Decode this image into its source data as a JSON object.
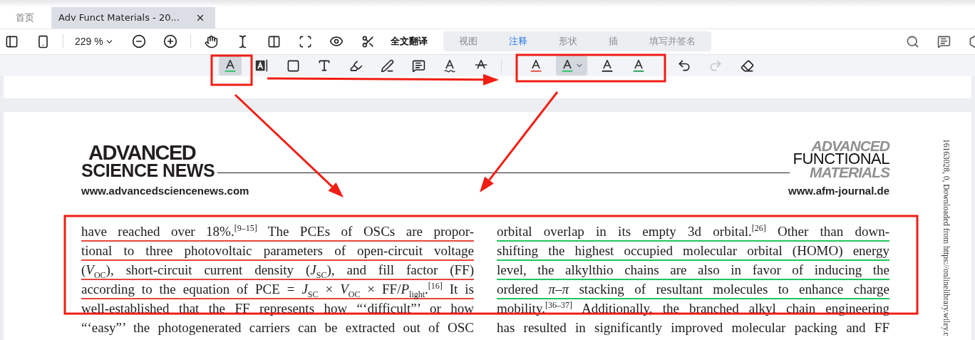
{
  "window_tabs": [
    {
      "label": "首页",
      "selected": false
    },
    {
      "label": "Adv Funct Materials - 20...",
      "selected": true
    }
  ],
  "toolbar": {
    "zoom": "229 %",
    "translate": "全文翻译",
    "modes": [
      {
        "label": "视图",
        "selected": false
      },
      {
        "label": "注释",
        "selected": true
      },
      {
        "label": "形状",
        "selected": false
      },
      {
        "label": "插",
        "selected": false
      },
      {
        "label": "填写并签名",
        "selected": false
      }
    ]
  },
  "annotation_tools": [
    {
      "kind": "highlight",
      "selected": true
    },
    {
      "kind": "textbox",
      "selected": false
    },
    {
      "kind": "rectangle",
      "selected": false
    },
    {
      "kind": "text",
      "selected": false
    },
    {
      "kind": "marker",
      "selected": false
    },
    {
      "kind": "pencil",
      "selected": false
    },
    {
      "kind": "note",
      "selected": false
    },
    {
      "kind": "squiggly",
      "selected": false
    },
    {
      "kind": "strikeout",
      "selected": false
    }
  ],
  "annotation_colors": [
    {
      "color": "#e8453c",
      "selected": false
    },
    {
      "color": "#22c55e",
      "selected": true
    },
    {
      "color": "#222222",
      "selected": false
    },
    {
      "color": "#1a9a4f",
      "selected": false
    }
  ],
  "history": [
    {
      "kind": "undo",
      "disabled": false
    },
    {
      "kind": "redo",
      "disabled": true
    }
  ],
  "document": {
    "left_logo": {
      "line_1": "ADVANCED",
      "line_2": "SCIENCE NEWS",
      "url": "www.advancedsciencenews.com"
    },
    "right_logo": {
      "line_1": "ADVANCED",
      "line_2": "FUNCTIONAL",
      "line_3": "MATERIALS",
      "url": "www.afm-journal.de"
    },
    "side_note": "16163028, 0, Downloaded from https://onlinelibrary.wiley.c",
    "columns": [
      {
        "color": "#e8453c",
        "lines": [
          {
            "text": "have reached over 18%.$^{[9–15]}$ The PCEs of OSCs are propor-",
            "underlined": true
          },
          {
            "text": "tional to three photovoltaic parameters of open-circuit voltage",
            "underlined": true
          },
          {
            "text": "(*V*$_{OC}$), short-circuit current density (*J*$_{SC}$), and fill factor (FF)",
            "underlined": true
          },
          {
            "text": "according to the equation of PCE = *J*$_{SC}$ × *V*$_{OC}$ × FF/*P*$_{light}$.$^{[16]}$ It is",
            "underlined": true
          },
          {
            "text": "well-established that the FF represents how “‘difficult”’ or how",
            "underlined": false
          },
          {
            "text": "“‘easy”’ the photogenerated carriers can be extracted out of OSC",
            "underlined": false
          }
        ]
      },
      {
        "color": "#22c55e",
        "lines": [
          {
            "text": "orbital overlap in its empty 3d orbital.$^{[26]}$ Other than down-",
            "underlined": true
          },
          {
            "text": "shifting the highest occupied molecular orbital (HOMO) energy",
            "underlined": true
          },
          {
            "text": "level, the alkylthio chains are also in favor of inducing the",
            "underlined": true
          },
          {
            "text": "ordered *π*–*π* stacking of resultant molecules to enhance charge",
            "underlined": true
          },
          {
            "text": "mobility.$^{[36–37]}$ Additionally, the branched alkyl chain engineering",
            "underlined": false
          },
          {
            "text": "has resulted in significantly improved molecular packing and FF",
            "underlined": false
          }
        ]
      }
    ]
  }
}
